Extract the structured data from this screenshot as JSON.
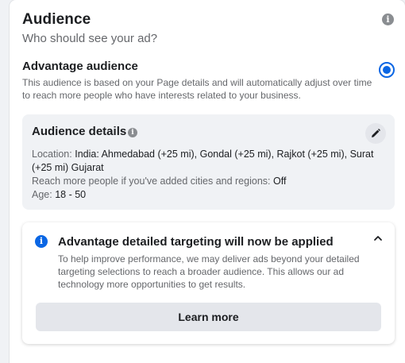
{
  "header": {
    "title": "Audience",
    "subtitle": "Who should see your ad?",
    "info_icon": "info-circle-icon"
  },
  "advantage": {
    "title": "Advantage audience",
    "description": "This audience is based on your Page details and will automatically adjust over time to reach more people who have interests related to your business.",
    "selected": true
  },
  "details": {
    "title": "Audience details",
    "location_label": "Location:",
    "location_value": "India: Ahmedabad (+25 mi), Gondal (+25 mi), Rajkot (+25 mi), Surat (+25 mi) Gujarat",
    "reach_label": "Reach more people if you've added cities and regions:",
    "reach_value": "Off",
    "age_label": "Age:",
    "age_value": "18 - 50"
  },
  "notice": {
    "title": "Advantage detailed targeting will now be applied",
    "body": "To help improve performance, we may deliver ads beyond your detailed targeting selections to reach a broader audience. This allows our ad technology more opportunities to get results.",
    "button_label": "Learn more"
  },
  "colors": {
    "accent": "#0a66e4",
    "background": "#f0f2f5"
  }
}
